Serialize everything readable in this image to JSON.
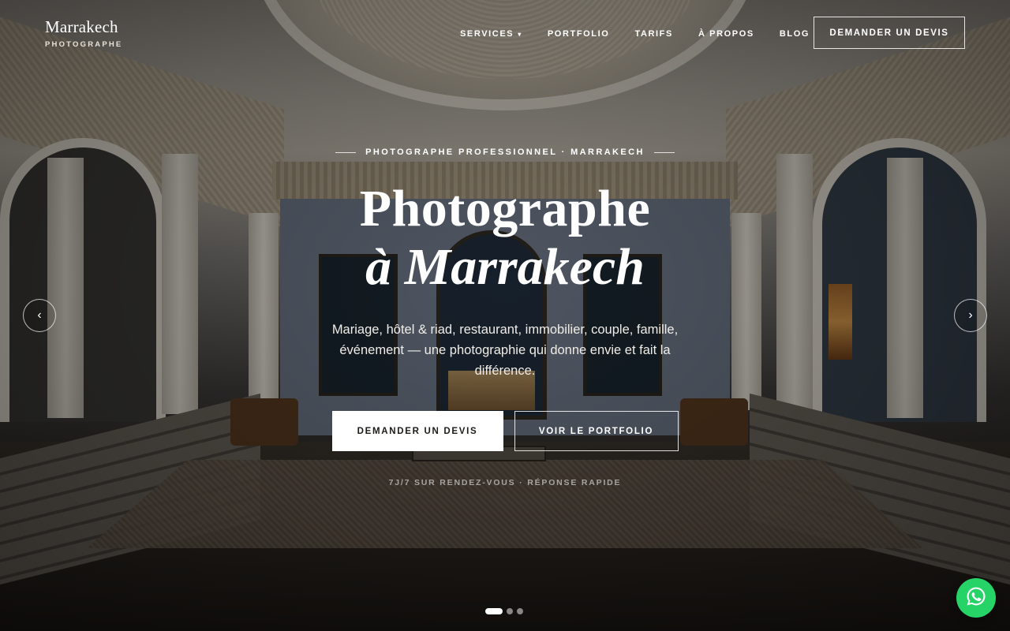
{
  "brand": {
    "name": "Marrakech",
    "tagline": "PHOTOGRAPHE"
  },
  "nav": {
    "items": [
      {
        "label": "SERVICES",
        "has_dropdown": true
      },
      {
        "label": "PORTFOLIO"
      },
      {
        "label": "TARIFS"
      },
      {
        "label": "À PROPOS"
      },
      {
        "label": "BLOG"
      }
    ],
    "cta_label": "DEMANDER UN DEVIS"
  },
  "hero": {
    "kicker": "PHOTOGRAPHE PROFESSIONNEL · MARRAKECH",
    "title_line1": "Photographe",
    "title_line2": "à Marrakech",
    "subtitle": "Mariage, hôtel & riad, restaurant, immobilier, couple, famille, événement — une photographie qui donne envie et fait la différence.",
    "primary_button": "DEMANDER UN DEVIS",
    "secondary_button": "VOIR LE PORTFOLIO",
    "note": "7J/7 SUR RENDEZ-VOUS · RÉPONSE RAPIDE"
  },
  "carousel": {
    "prev_icon": "chevron-left-icon",
    "next_icon": "chevron-right-icon",
    "prev_glyph": "‹",
    "next_glyph": "›",
    "slide_count": 3,
    "active_index": 0
  },
  "floating": {
    "whatsapp_icon": "whatsapp-icon",
    "color": "#25d366"
  }
}
